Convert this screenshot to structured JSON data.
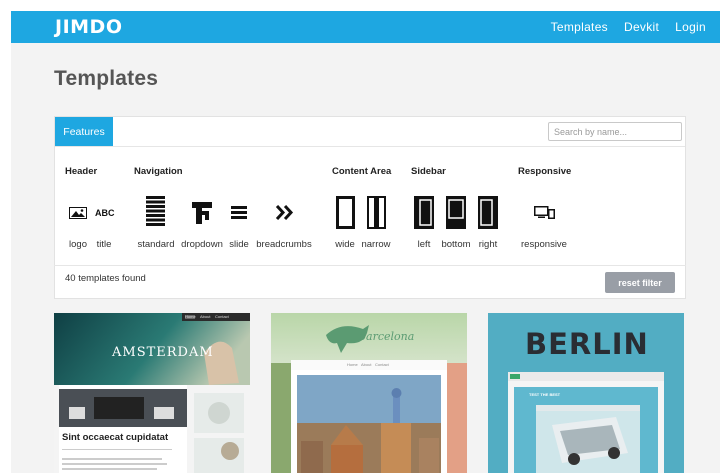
{
  "header": {
    "logo_text": "JIMDO",
    "nav": [
      "Templates",
      "Devkit",
      "Login"
    ]
  },
  "page_title": "Templates",
  "filter": {
    "tab_label": "Features",
    "search_placeholder": "Search by name...",
    "groups": {
      "header": "Header",
      "navigation": "Navigation",
      "content": "Content Area",
      "sidebar": "Sidebar",
      "responsive": "Responsive"
    },
    "features": {
      "logo": "logo",
      "title": "title",
      "title_icon_text": "ABC",
      "standard": "standard",
      "dropdown": "dropdown",
      "slide": "slide",
      "breadcrumbs": "breadcrumbs",
      "wide": "wide",
      "narrow": "narrow",
      "left": "left",
      "bottom": "bottom",
      "right": "right",
      "responsive": "responsive"
    },
    "found_text": "40 templates found",
    "reset_label": "reset filter"
  },
  "templates": {
    "amsterdam": {
      "hero_text": "AMSTERDAM",
      "nav_items": [
        "Home",
        "About",
        "Contact"
      ],
      "headline": "Sint occaecat cupidatat"
    },
    "barcelona": {
      "hero_text": "barcelona",
      "nav_items": [
        "Home",
        "About",
        "Contact"
      ]
    },
    "berlin": {
      "hero_text": "BERLIN",
      "banner_text": "TEST THE BEST"
    }
  },
  "colors": {
    "brand": "#1ea7e1",
    "reset_button": "#999ea6"
  }
}
